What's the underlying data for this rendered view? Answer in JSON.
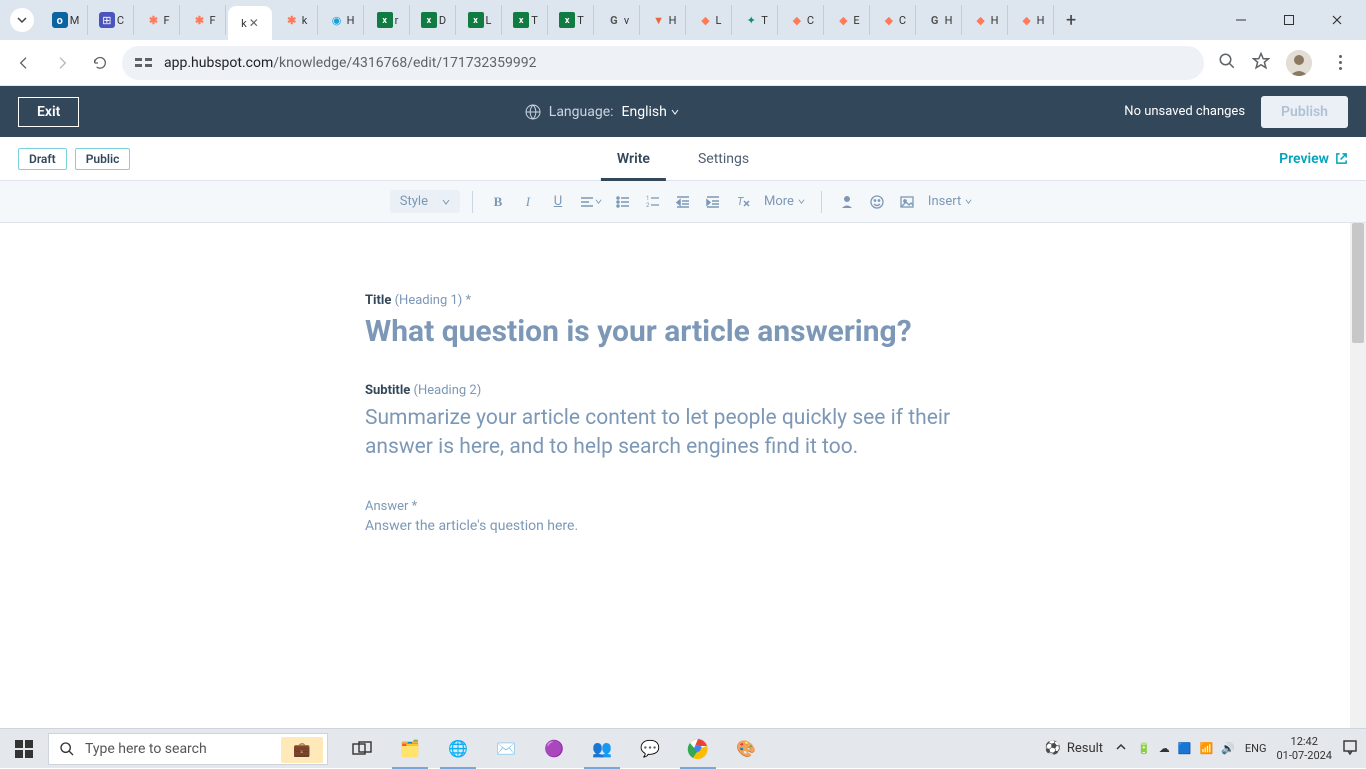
{
  "browser": {
    "tabs": [
      {
        "fav": "outlook",
        "letter": "M"
      },
      {
        "fav": "teams",
        "letter": "C"
      },
      {
        "fav": "hub",
        "letter": "F"
      },
      {
        "fav": "hub",
        "letter": "F"
      },
      {
        "fav": "active",
        "letter": "k"
      },
      {
        "fav": "hub",
        "letter": "k"
      },
      {
        "fav": "blue",
        "letter": "H"
      },
      {
        "fav": "excel",
        "letter": "r"
      },
      {
        "fav": "excel",
        "letter": "D"
      },
      {
        "fav": "excel",
        "letter": "L"
      },
      {
        "fav": "excel",
        "letter": "T"
      },
      {
        "fav": "excel",
        "letter": "T"
      },
      {
        "fav": "google",
        "letter": "v"
      },
      {
        "fav": "other1",
        "letter": "H"
      },
      {
        "fav": "hub2",
        "letter": "L"
      },
      {
        "fav": "other2",
        "letter": "T"
      },
      {
        "fav": "hub2",
        "letter": "C"
      },
      {
        "fav": "hub2",
        "letter": "E"
      },
      {
        "fav": "hub2",
        "letter": "C"
      },
      {
        "fav": "google",
        "letter": "H"
      },
      {
        "fav": "hub2",
        "letter": "H"
      },
      {
        "fav": "hub2",
        "letter": "H"
      }
    ],
    "url_host": "app.hubspot.com",
    "url_path": "/knowledge/4316768/edit/171732359992"
  },
  "header": {
    "exit": "Exit",
    "language_label": "Language:",
    "language_value": "English",
    "unsaved": "No unsaved changes",
    "publish": "Publish"
  },
  "subheader": {
    "draft": "Draft",
    "public": "Public",
    "write": "Write",
    "settings": "Settings",
    "preview": "Preview"
  },
  "toolbar": {
    "style": "Style",
    "more": "More",
    "insert": "Insert"
  },
  "editor": {
    "title_label": "Title",
    "title_hint": "(Heading 1)",
    "title_req": "*",
    "title_placeholder": "What question is your article answering?",
    "subtitle_label": "Subtitle",
    "subtitle_hint": "(Heading 2)",
    "subtitle_placeholder": "Summarize your article content to let people quickly see if their answer is here, and to help search engines find it too.",
    "answer_label": "Answer",
    "answer_req": "*",
    "answer_placeholder": "Answer the article's question here."
  },
  "taskbar": {
    "search_placeholder": "Type here to search",
    "result": "Result",
    "lang": "ENG",
    "time": "12:42",
    "date": "01-07-2024"
  }
}
